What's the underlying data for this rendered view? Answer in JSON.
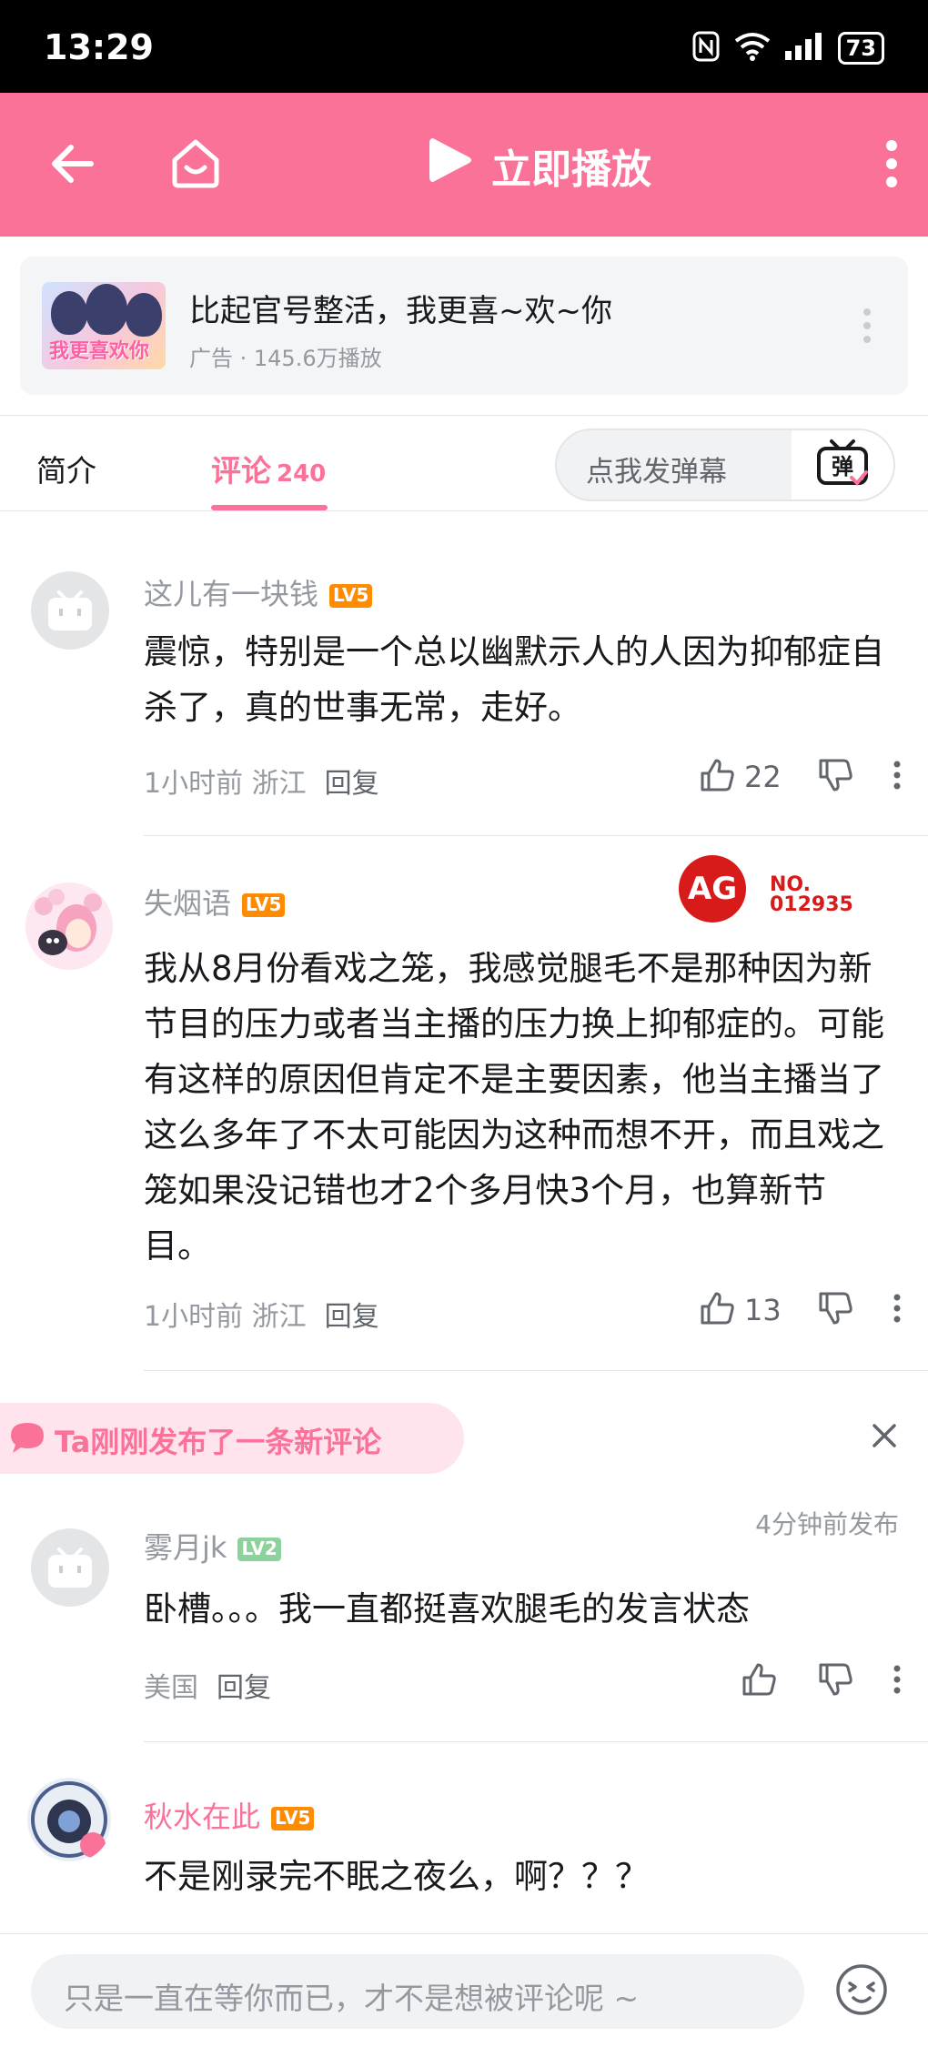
{
  "status_bar": {
    "time": "13:29",
    "battery": "73"
  },
  "nav": {
    "play_label": "立即播放"
  },
  "ad": {
    "thumb_text": "我更喜欢你",
    "title": "比起官号整活，我更喜~欢~你",
    "subtitle": "广告 · 145.6万播放"
  },
  "tabs": {
    "intro": "简介",
    "comments": "评论",
    "comment_count": "240",
    "danmaku_placeholder": "点我发弹幕",
    "danmaku_button": "弹"
  },
  "comments": [
    {
      "username": "这儿有一块钱",
      "level": "LV5",
      "body": "震惊，特别是一个总以幽默示人的人因为抑郁症自杀了，真的世事无常，走好。",
      "meta": "1小时前 浙江",
      "reply": "回复",
      "likes": "22"
    },
    {
      "username": "失烟语",
      "level": "LV5",
      "body": "我从8月份看戏之笼，我感觉腿毛不是那种因为新节目的压力或者当主播的压力换上抑郁症的。可能有这样的原因但肯定不是主要因素，他当主播当了这么多年了不太可能因为这种而想不开，而且戏之笼如果没记错也才2个多月快3个月，也算新节目。",
      "meta": "1小时前 浙江",
      "reply": "回复",
      "likes": "13",
      "badge": "AG",
      "badge_no_label": "NO.",
      "badge_no": "012935"
    },
    {
      "username": "雾月jk",
      "level": "LV2",
      "body": "卧槽。。。我一直都挺喜欢腿毛的发言状态",
      "meta": "美国",
      "reply": "回复",
      "posted": "4分钟前发布"
    },
    {
      "username": "秋水在此",
      "level": "LV5",
      "body": "不是刚录完不眠之夜么，啊？？？"
    }
  ],
  "new_comment_notice": "Ta刚刚发布了一条新评论",
  "bottom": {
    "input_placeholder": "只是一直在等你而已，才不是想被评论呢 ~"
  },
  "colors": {
    "accent": "#fb7299",
    "level_orange": "#ff8b00",
    "level_green": "#8bd29b"
  }
}
